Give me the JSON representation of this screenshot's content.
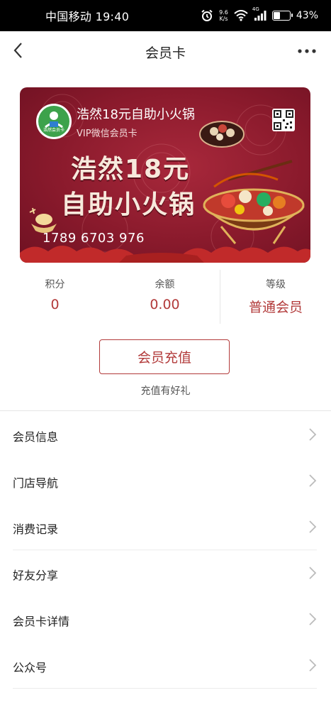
{
  "status_bar": {
    "carrier_time": "中国移动 19:40",
    "speed_value": "9.6",
    "speed_unit": "K/s",
    "network": "4G",
    "battery_pct": "43%",
    "battery_level": 0.43
  },
  "nav": {
    "title": "会员卡"
  },
  "card": {
    "name": "浩然18元自助小火锅",
    "subtitle": "VIP微信会员卡",
    "headline_line1": "浩然18元",
    "headline_line2": "自助小火锅",
    "number": "1789 6703 976",
    "logo_text": "浩然会员卡",
    "colors": {
      "bg": "#8a1a2c",
      "accent": "#f7e9dc"
    }
  },
  "stats": [
    {
      "label": "积分",
      "value": "0"
    },
    {
      "label": "余额",
      "value": "0.00"
    },
    {
      "label": "等级",
      "value": "普通会员"
    }
  ],
  "recharge": {
    "button_label": "会员充值",
    "hint": "充值有好礼"
  },
  "menu": [
    {
      "label": "会员信息"
    },
    {
      "label": "门店导航"
    },
    {
      "label": "消费记录"
    },
    {
      "label": "好友分享"
    },
    {
      "label": "会员卡详情"
    },
    {
      "label": "公众号"
    }
  ],
  "icons": {
    "back": "chevron-left-icon",
    "more": "more-dots-icon",
    "alarm": "alarm-icon",
    "wifi": "wifi-icon",
    "signal": "signal-icon",
    "qr": "qr-code-icon",
    "arrow": "chevron-right-icon"
  },
  "theme": {
    "primary": "#b23a3a"
  }
}
